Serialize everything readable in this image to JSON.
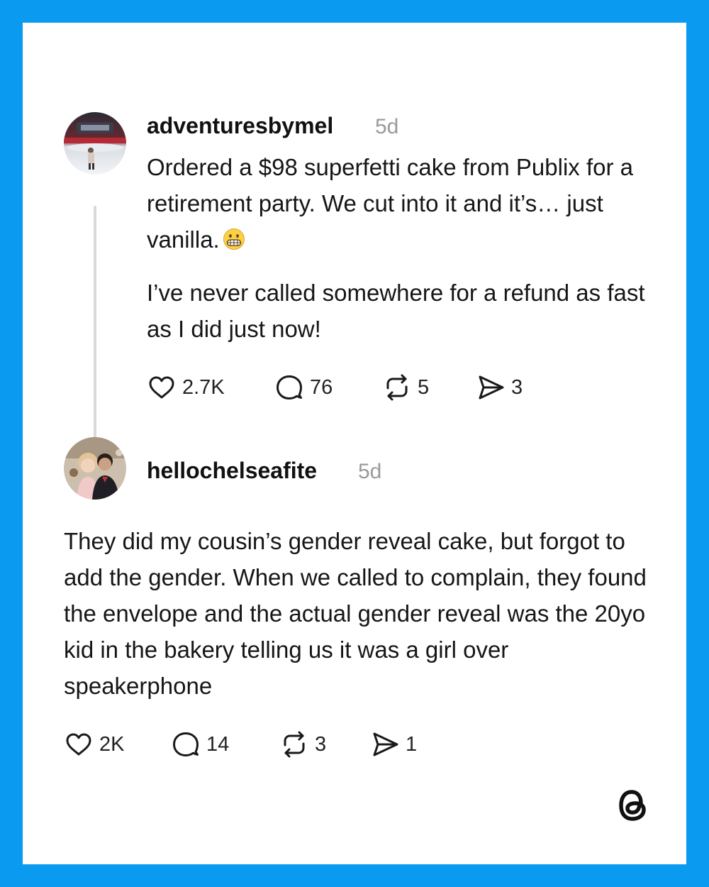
{
  "posts": [
    {
      "username": "adventuresbymel",
      "time": "5d",
      "paragraphs": [
        "Ordered a $98 superfetti cake from Publix for a retirement party. We cut into it and it’s… just vanilla.",
        "I’ve never called somewhere for a refund as fast as I did just now!"
      ],
      "emoji": "grimacing-face",
      "likes": "2.7K",
      "replies": "76",
      "reposts": "5",
      "shares": "3"
    },
    {
      "username": "hellochelseafite",
      "time": "5d",
      "paragraphs": [
        "They did my cousin’s gender reveal cake, but forgot to add the gender. When we called to complain, they found the envelope and the actual gender reveal was the 20yo kid in the bakery telling us it was a girl over speakerphone"
      ],
      "likes": "2K",
      "replies": "14",
      "reposts": "3",
      "shares": "1"
    }
  ],
  "icons": {
    "like": "heart-icon",
    "reply": "speech-bubble-icon",
    "repost": "repost-arrows-icon",
    "share": "send-icon",
    "brand": "threads-logo"
  },
  "colors": {
    "frame": "#0a9bf0",
    "card": "#ffffff",
    "muted": "#9a9a9a",
    "thread_line": "#d9d9d9"
  }
}
